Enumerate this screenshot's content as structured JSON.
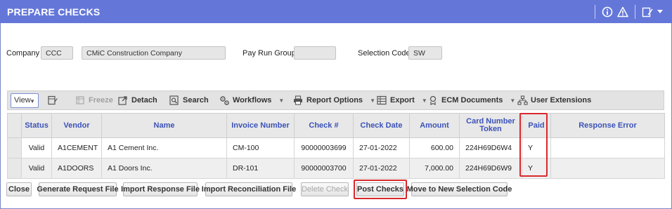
{
  "page": {
    "title": "PREPARE CHECKS"
  },
  "header_icons": [
    "info-icon",
    "warning-icon",
    "edit-icon",
    "dropdown-arrow-icon"
  ],
  "fields": {
    "company_label": "Company",
    "company_code": "CCC",
    "company_name": "CMiC Construction Company",
    "pay_run_group_label": "Pay Run Group",
    "pay_run_group_value": "",
    "selection_code_label": "Selection Code",
    "selection_code_value": "SW"
  },
  "toolbar": {
    "view_label": "View",
    "freeze": "Freeze",
    "detach": "Detach",
    "search": "Search",
    "workflows": "Workflows",
    "report_options": "Report Options",
    "export": "Export",
    "ecm_documents": "ECM Documents",
    "user_extensions": "User Extensions"
  },
  "table": {
    "headers": [
      "Status",
      "Vendor",
      "Name",
      "Invoice Number",
      "Check #",
      "Check Date",
      "Amount",
      "Card Number Token",
      "Paid",
      "Response Error"
    ],
    "rows": [
      {
        "status": "Valid",
        "vendor": "A1CEMENT",
        "name": "A1 Cement Inc.",
        "invoice": "CM-100",
        "check": "90000003699",
        "date": "27-01-2022",
        "amount": "600.00",
        "token": "224H69D6W4",
        "paid": "Y",
        "error": ""
      },
      {
        "status": "Valid",
        "vendor": "A1DOORS",
        "name": "A1 Doors Inc.",
        "invoice": "DR-101",
        "check": "90000003700",
        "date": "27-01-2022",
        "amount": "7,000.00",
        "token": "224H69D6W9",
        "paid": "Y",
        "error": ""
      }
    ]
  },
  "buttons": {
    "close": "Close",
    "generate_request_file": "Generate Request File",
    "import_response_file": "Import Response File",
    "import_reconciliation_file": "Import Reconciliation File",
    "delete_check": "Delete Check",
    "post_checks": "Post Checks",
    "move_to_new_selection_code": "Move to New Selection Code"
  },
  "colors": {
    "title_bar": "#6477d9",
    "header_text": "#3b52b8",
    "highlight": "#d9292b"
  }
}
